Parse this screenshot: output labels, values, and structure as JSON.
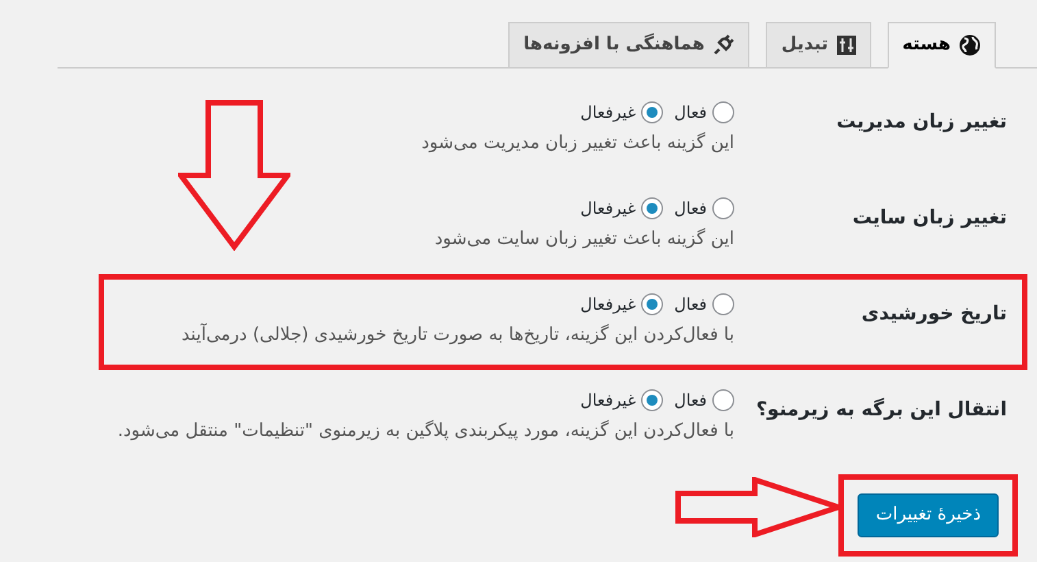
{
  "tabs": [
    {
      "label": "هسته",
      "selected": true
    },
    {
      "label": "تبدیل",
      "selected": false
    },
    {
      "label": "هماهنگی با افزونه‌ها",
      "selected": false
    }
  ],
  "settings": [
    {
      "label": "تغییر زبان مدیریت",
      "options": [
        {
          "label": "فعال",
          "selected": false
        },
        {
          "label": "غیرفعال",
          "selected": true
        }
      ],
      "description": "این گزینه باعث تغییر زبان مدیریت می‌شود",
      "highlighted": false
    },
    {
      "label": "تغییر زبان سایت",
      "options": [
        {
          "label": "فعال",
          "selected": false
        },
        {
          "label": "غیرفعال",
          "selected": true
        }
      ],
      "description": "این گزینه باعث تغییر زبان سایت می‌شود",
      "highlighted": false
    },
    {
      "label": "تاریخ خورشیدی",
      "options": [
        {
          "label": "فعال",
          "selected": false
        },
        {
          "label": "غیرفعال",
          "selected": true
        }
      ],
      "description": "با فعال‌کردن این گزینه، تاریخ‌ها به صورت تاریخ خورشیدی (جلالی) درمی‌آیند",
      "highlighted": true
    },
    {
      "label": "انتقال این برگه به زیرمنو؟",
      "options": [
        {
          "label": "فعال",
          "selected": false
        },
        {
          "label": "غیرفعال",
          "selected": true
        }
      ],
      "description": "با فعال‌کردن این گزینه، مورد پیکربندی پلاگین به زیرمنوی \"تنظیمات\" منتقل می‌شود.",
      "highlighted": false
    }
  ],
  "save_button": {
    "label": "ذخیرهٔ تغییرات",
    "highlighted": true
  }
}
